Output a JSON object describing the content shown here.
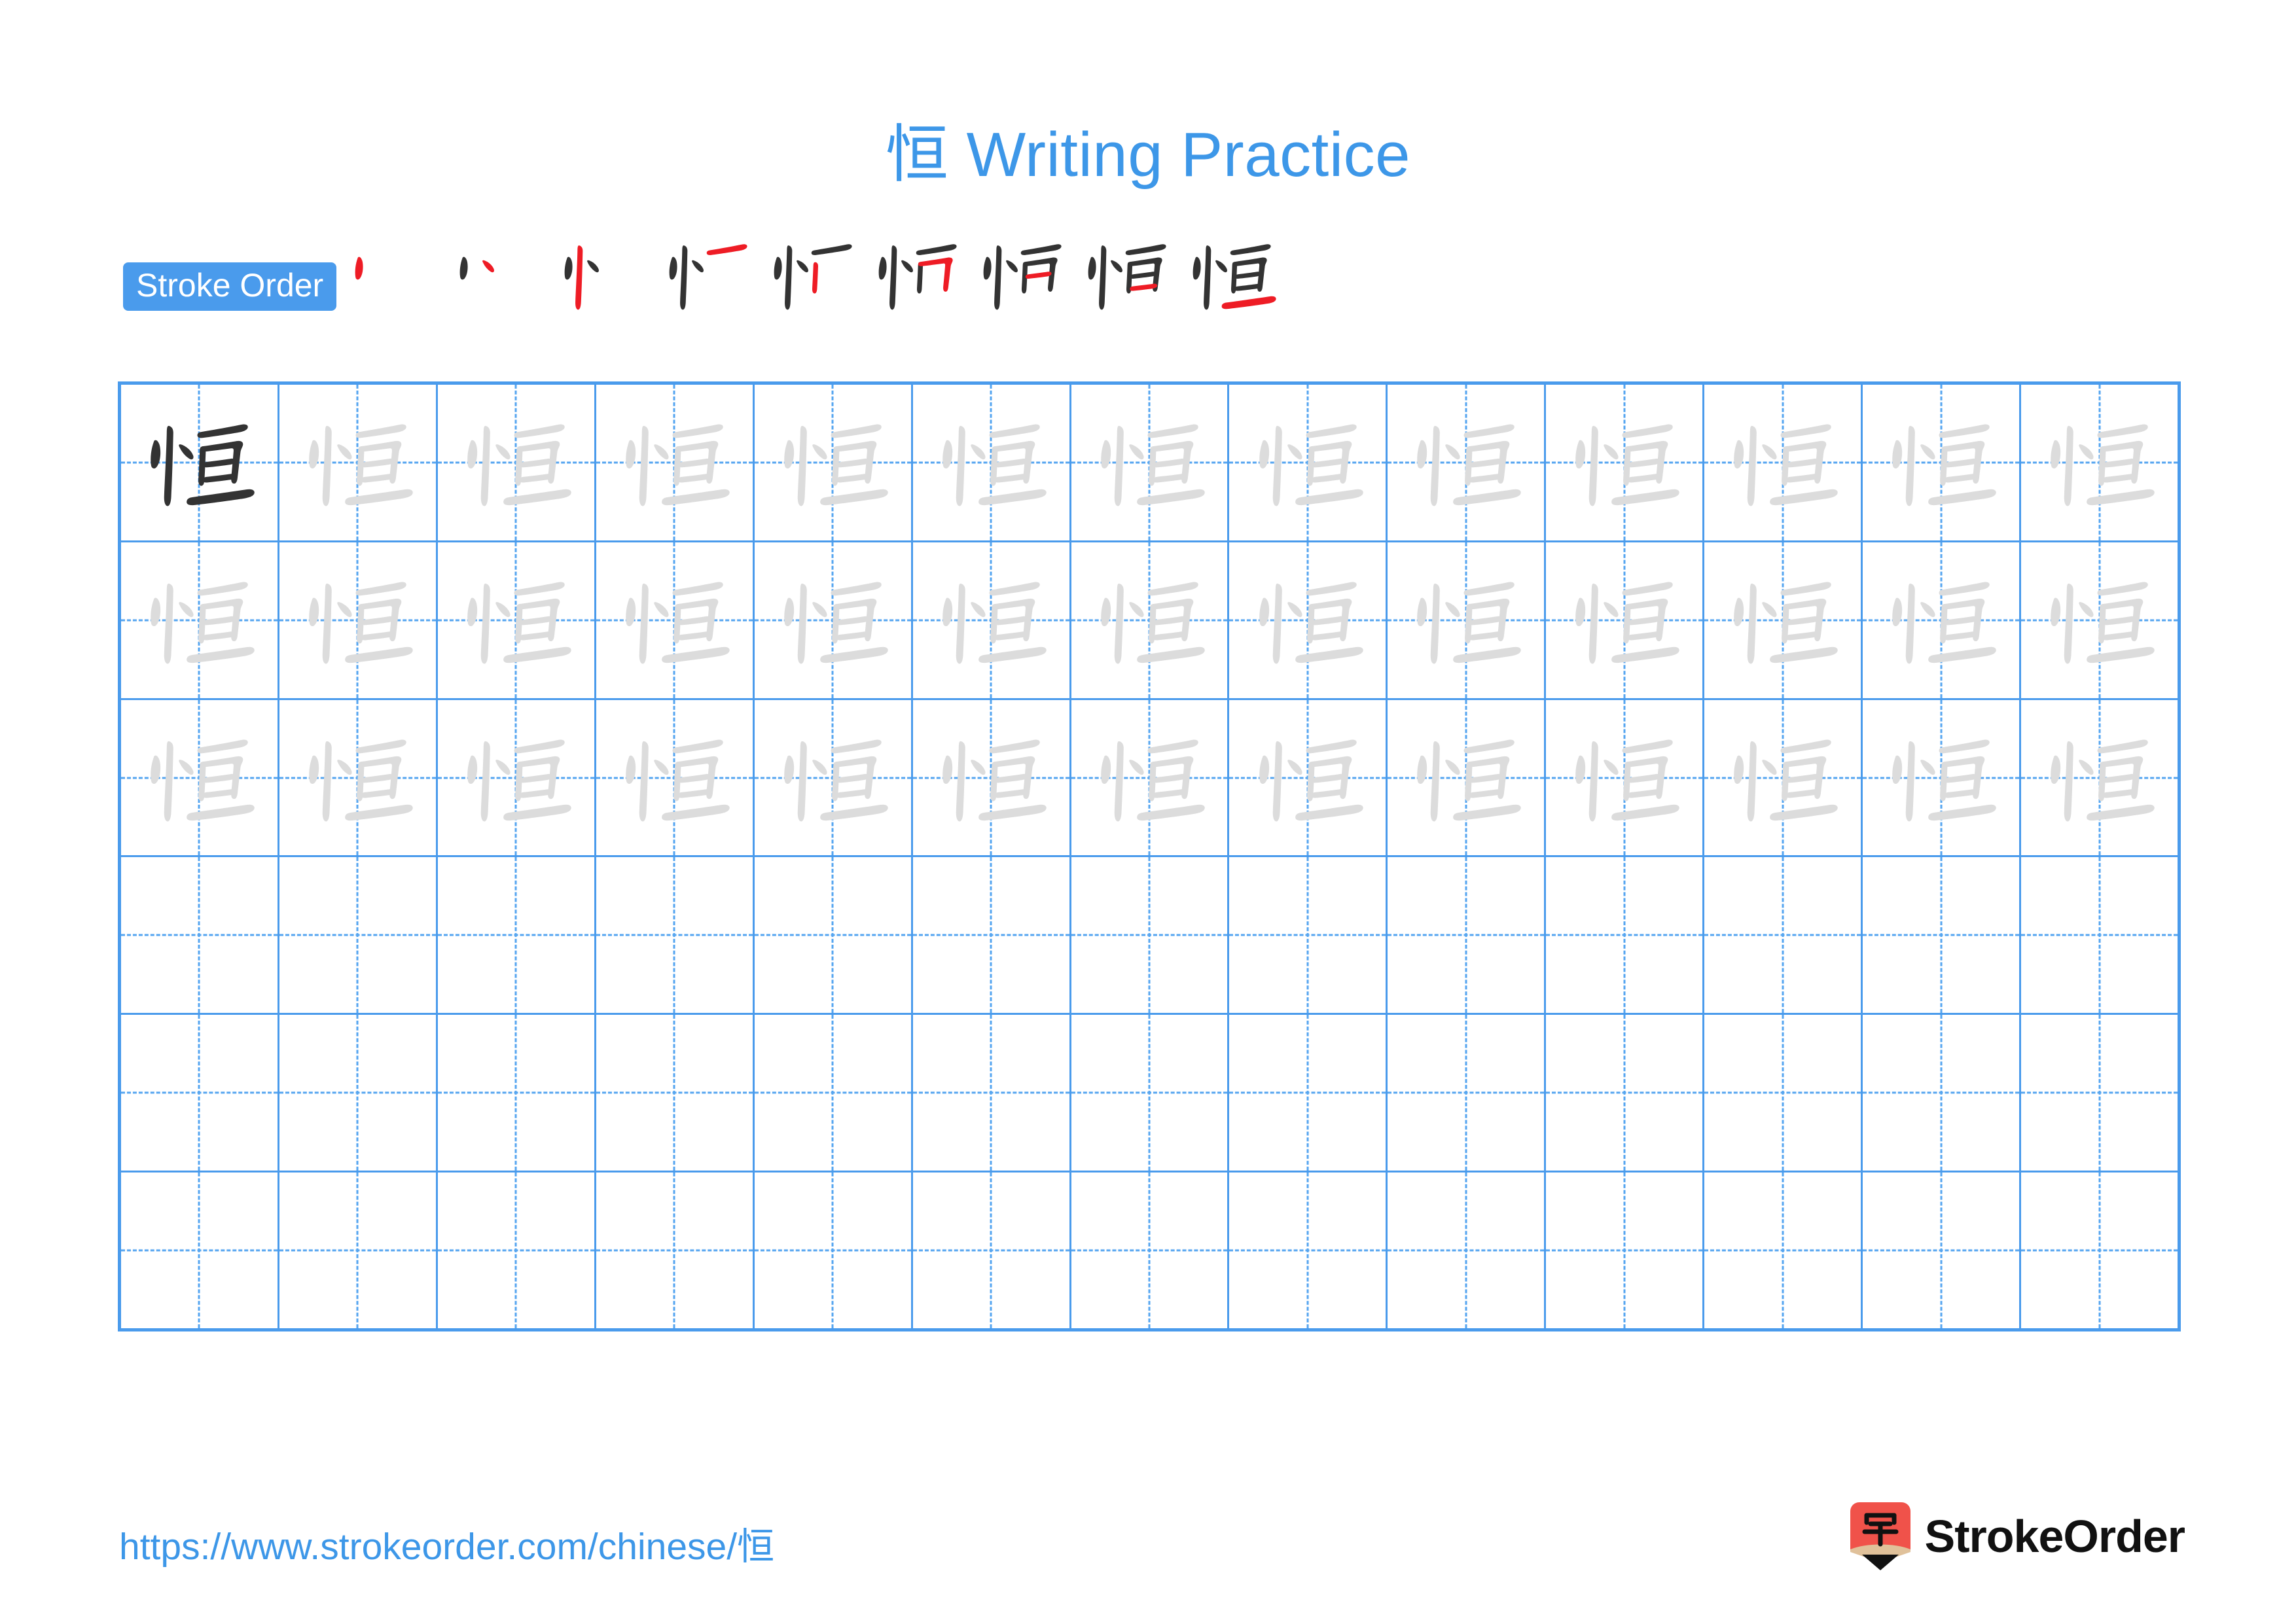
{
  "document": {
    "character": "恒",
    "title_prefix": "恒",
    "title_text": " Writing Practice",
    "title_full": "恒 Writing Practice",
    "accent_color": "#3d97e8",
    "grid_color": "#4a9bec",
    "trace_color": "#dcdcdc",
    "ink_color": "#333333",
    "highlight_color": "#ee1c25"
  },
  "stroke_order": {
    "badge_label": "Stroke Order",
    "stroke_count": 9,
    "steps": [
      {
        "index": 1,
        "name": "stroke-step-1",
        "new_stroke": "dot-left"
      },
      {
        "index": 2,
        "name": "stroke-step-2",
        "new_stroke": "dot-right"
      },
      {
        "index": 3,
        "name": "stroke-step-3",
        "new_stroke": "vertical"
      },
      {
        "index": 4,
        "name": "stroke-step-4",
        "new_stroke": "horizontal-top"
      },
      {
        "index": 5,
        "name": "stroke-step-5",
        "new_stroke": "vertical-right"
      },
      {
        "index": 6,
        "name": "stroke-step-6",
        "new_stroke": "hook-turn"
      },
      {
        "index": 7,
        "name": "stroke-step-7",
        "new_stroke": "horizontal-mid-1"
      },
      {
        "index": 8,
        "name": "stroke-step-8",
        "new_stroke": "horizontal-mid-2"
      },
      {
        "index": 9,
        "name": "stroke-step-9",
        "new_stroke": "horizontal-bottom"
      }
    ]
  },
  "practice_grid": {
    "columns": 13,
    "rows": 6,
    "filled_rows": 3,
    "empty_rows": 3,
    "first_cell_is_solid": true,
    "cells": [
      [
        "solid",
        "trace",
        "trace",
        "trace",
        "trace",
        "trace",
        "trace",
        "trace",
        "trace",
        "trace",
        "trace",
        "trace",
        "trace"
      ],
      [
        "trace",
        "trace",
        "trace",
        "trace",
        "trace",
        "trace",
        "trace",
        "trace",
        "trace",
        "trace",
        "trace",
        "trace",
        "trace"
      ],
      [
        "trace",
        "trace",
        "trace",
        "trace",
        "trace",
        "trace",
        "trace",
        "trace",
        "trace",
        "trace",
        "trace",
        "trace",
        "trace"
      ],
      [
        "empty",
        "empty",
        "empty",
        "empty",
        "empty",
        "empty",
        "empty",
        "empty",
        "empty",
        "empty",
        "empty",
        "empty",
        "empty"
      ],
      [
        "empty",
        "empty",
        "empty",
        "empty",
        "empty",
        "empty",
        "empty",
        "empty",
        "empty",
        "empty",
        "empty",
        "empty",
        "empty"
      ],
      [
        "empty",
        "empty",
        "empty",
        "empty",
        "empty",
        "empty",
        "empty",
        "empty",
        "empty",
        "empty",
        "empty",
        "empty",
        "empty"
      ]
    ]
  },
  "footer": {
    "url_prefix": "https://www.strokeorder.com/chinese/",
    "url_character": "恒",
    "url_full": "https://www.strokeorder.com/chinese/恒",
    "brand_name": "StrokeOrder",
    "logo_character": "字",
    "logo_body_color": "#f0524a",
    "logo_tip_color": "#e0c19a",
    "logo_point_color": "#111111"
  }
}
